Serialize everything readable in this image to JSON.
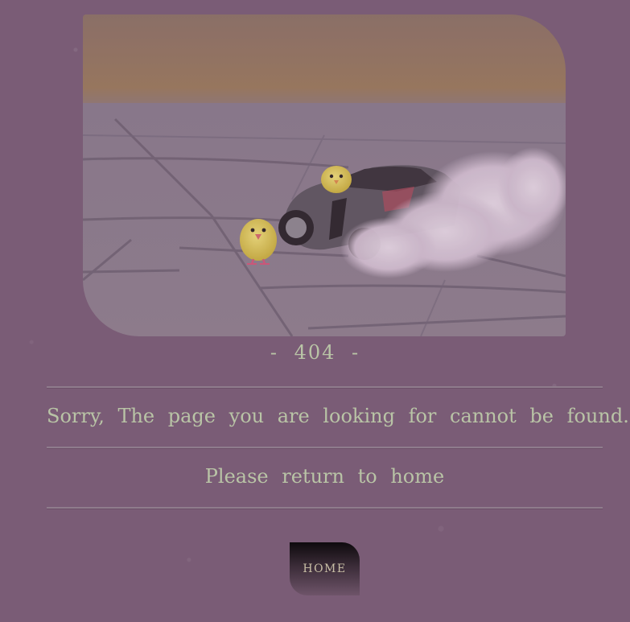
{
  "error": {
    "code_text": "-  404  -",
    "message": "Sorry, The page you are looking for cannot be found.",
    "instruction": "Please return to home"
  },
  "actions": {
    "home_label": "HOME"
  },
  "colors": {
    "background": "#7a5c76",
    "text": "#b9c4a6",
    "button_top": "#0e0a0d",
    "button_bottom": "#6e5469"
  },
  "image": {
    "subject": "toy sports car drifting with smoke and two yellow toy chicks on paving stones"
  }
}
